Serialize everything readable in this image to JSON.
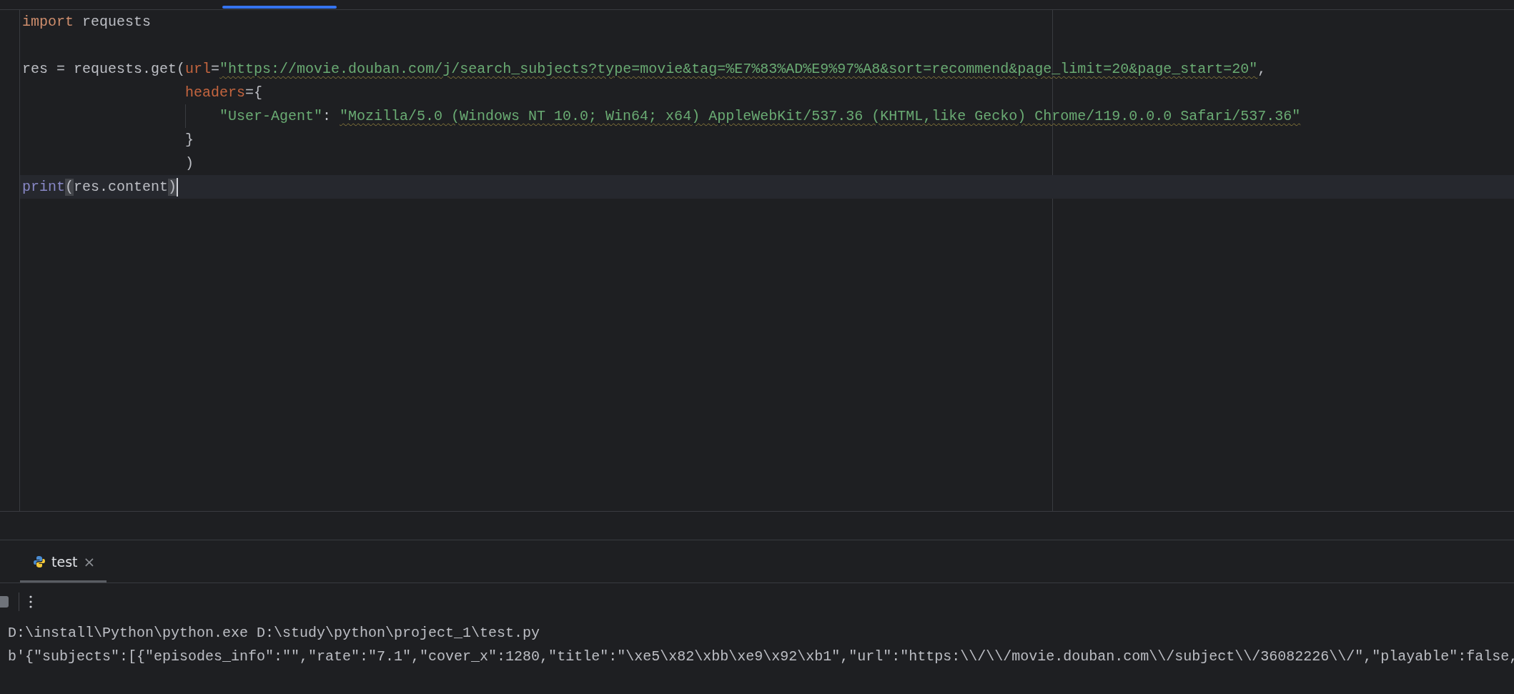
{
  "editor": {
    "lines": [
      {
        "current": false,
        "tokens": [
          {
            "text": "import",
            "kind": "keyword"
          },
          {
            "text": " requests",
            "kind": "plain"
          }
        ]
      },
      {
        "current": false
      },
      {
        "current": false,
        "tokens": [
          {
            "text": "res = requests.get(",
            "kind": "plain"
          },
          {
            "text": "url",
            "kind": "param"
          },
          {
            "text": "=",
            "kind": "plain"
          },
          {
            "text": "\"https://movie.douban.com/j/search_subjects?type=movie&tag=%E7%83%AD%E9%97%A8&sort=recommend&page_limit=20&page_start=20\"",
            "kind": "string",
            "underlined": true
          },
          {
            "text": ",",
            "kind": "plain"
          }
        ]
      },
      {
        "current": false,
        "kind": "continuation",
        "tokens": [
          {
            "text": "headers",
            "kind": "param"
          },
          {
            "text": "={",
            "kind": "plain"
          }
        ]
      },
      {
        "current": false,
        "kind": "entry",
        "tokens": [
          {
            "text": "\"User-Agent\"",
            "kind": "string"
          },
          {
            "text": ": ",
            "kind": "plain"
          },
          {
            "text": "\"Mozilla/5.0 (Windows NT 10.0; Win64; x64) AppleWebKit/537.36 (KHTML,like Gecko) Chrome/119.0.0.0 Safari/537.36\"",
            "kind": "string",
            "underlined": true
          }
        ]
      },
      {
        "current": false,
        "kind": "continuation",
        "tokens": [
          {
            "text": "}",
            "kind": "plain"
          }
        ]
      },
      {
        "current": false,
        "kind": "continuation",
        "tokens": [
          {
            "text": ")",
            "kind": "plain"
          }
        ]
      },
      {
        "current": true,
        "tokens": [
          {
            "text": "print",
            "kind": "builtin"
          },
          {
            "text": "(",
            "kind": "brace"
          },
          {
            "text": "res.content",
            "kind": "plain"
          },
          {
            "text": ")",
            "kind": "brace"
          }
        ]
      }
    ]
  },
  "run_panel": {
    "tabs": [
      {
        "label": "test",
        "close": "×",
        "selected": true
      }
    ],
    "output": [
      "D:\\install\\Python\\python.exe D:\\study\\python\\project_1\\test.py",
      "b'{\"subjects\":[{\"episodes_info\":\"\",\"rate\":\"7.1\",\"cover_x\":1280,\"title\":\"\\xe5\\x82\\xbb\\xe9\\x92\\xb1\",\"url\":\"https:\\\\/\\\\/movie.douban.com\\\\/subject\\\\/36082226\\\\/\",\"playable\":false,"
    ]
  }
}
